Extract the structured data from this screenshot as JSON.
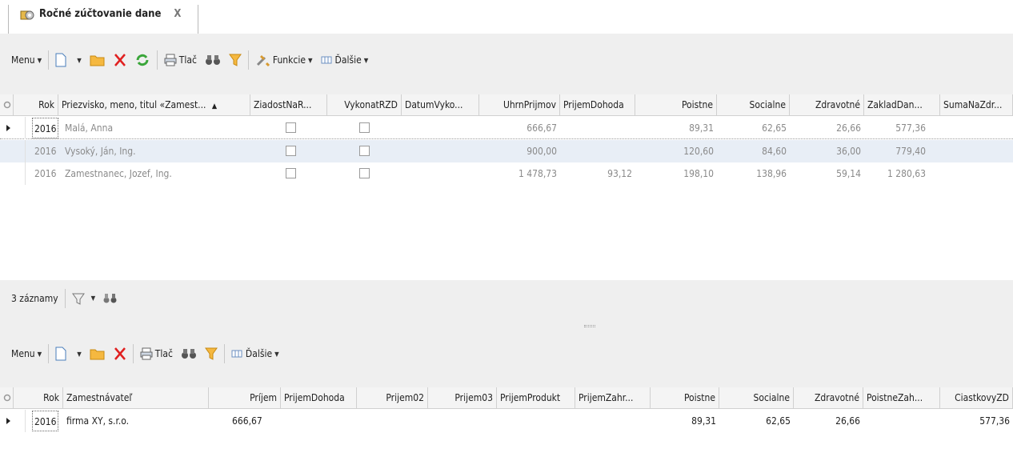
{
  "tab": {
    "title": "Ročné zúčtovanie dane",
    "close": "X",
    "icon": "tax-report-icon"
  },
  "toolbar_top": {
    "menu": "Menu",
    "print": "Tlač",
    "functions": "Funkcie",
    "more": "Ďalšie"
  },
  "grid_top": {
    "columns": [
      "Rok",
      "Priezvisko, meno, titul «Zamest...",
      "ZiadostNaR...",
      "VykonatRZD",
      "DatumVyko...",
      "UhrnPrijmov",
      "PrijemDohoda",
      "Poistne",
      "Socialne",
      "Zdravotné",
      "ZakladDan...",
      "SumaNaZdr..."
    ],
    "sort_indicator": "▲",
    "rows": [
      {
        "rok": "2016",
        "meno": "Malá, Anna",
        "uhrn": "666,67",
        "dohoda": "",
        "poistne": "89,31",
        "socialne": "62,65",
        "zdravotne": "26,66",
        "zaklad": "577,36"
      },
      {
        "rok": "2016",
        "meno": "Vysoký, Ján, Ing.",
        "uhrn": "900,00",
        "dohoda": "",
        "poistne": "120,60",
        "socialne": "84,60",
        "zdravotne": "36,00",
        "zaklad": "779,40"
      },
      {
        "rok": "2016",
        "meno": "Zamestnanec, Jozef, Ing.",
        "uhrn": "1 478,73",
        "dohoda": "93,12",
        "poistne": "198,10",
        "socialne": "138,96",
        "zdravotne": "59,14",
        "zaklad": "1 280,63"
      }
    ]
  },
  "status": {
    "count": "3 záznamy"
  },
  "toolbar_bottom": {
    "menu": "Menu",
    "print": "Tlač",
    "more": "Ďalšie"
  },
  "grid_bottom": {
    "columns": [
      "Rok",
      "Zamestnávateľ",
      "Príjem",
      "PrijemDohoda",
      "Prijem02",
      "Prijem03",
      "PrijemProdukt",
      "PrijemZahr...",
      "Poistne",
      "Socialne",
      "Zdravotné",
      "PoistneZah...",
      "CiastkovyZD"
    ],
    "rows": [
      {
        "rok": "2016",
        "zamestnavatel": "firma XY, s.r.o.",
        "prijem": "666,67",
        "poistne": "89,31",
        "socialne": "62,65",
        "zdravotne": "26,66",
        "ciastkovy": "577,36"
      }
    ]
  },
  "colors": {
    "panel": "#efefef",
    "header": "#f4f4f4",
    "selected_row": "#e8eef6",
    "dim_text": "#8a8a8a"
  }
}
